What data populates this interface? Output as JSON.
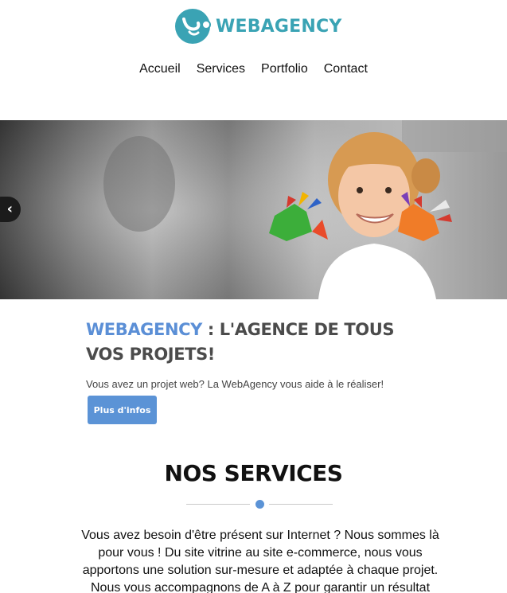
{
  "header": {
    "logo_text": "WEBAGENCY",
    "logo_color": "#3aa3b4"
  },
  "nav": {
    "items": [
      {
        "label": "Accueil"
      },
      {
        "label": "Services"
      },
      {
        "label": "Portfolio"
      },
      {
        "label": "Contact"
      }
    ]
  },
  "hero": {
    "prev_icon": "chevron-left-icon",
    "prev_symbol": "‹"
  },
  "intro": {
    "brand": "WEBAGENCY",
    "title_rest": " : L'AGENCE DE TOUS VOS PROJETS!",
    "subtitle": "Vous avez un projet web? La WebAgency vous aide à le réaliser!",
    "button_label": "Plus d'infos",
    "accent_color": "#5b93d6"
  },
  "services": {
    "title": "NOS SERVICES",
    "text": "Vous avez besoin d'être présent sur Internet ? Nous sommes là pour vous ! Du site vitrine au site e-commerce, nous vous apportons une solution sur-mesure et adaptée à chaque projet. Nous vous accompagnons de A à Z pour garantir un résultat"
  }
}
